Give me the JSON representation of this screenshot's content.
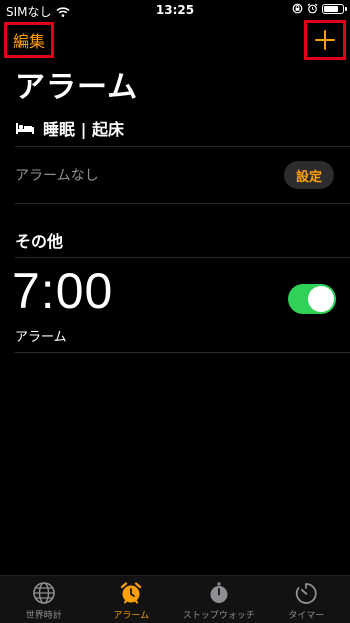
{
  "status_bar": {
    "carrier": "SIMなし",
    "time": "13:25",
    "battery_level": 0.85
  },
  "header": {
    "edit_label": "編集",
    "add_icon": "plus-icon",
    "title": "アラーム"
  },
  "sleep_section": {
    "icon": "bed-icon",
    "label": "睡眠 | 起床",
    "no_alarm_text": "アラームなし",
    "setup_label": "設定"
  },
  "other_section": {
    "heading": "その他",
    "alarms": [
      {
        "time": "7:00",
        "label": "アラーム",
        "enabled": true
      }
    ]
  },
  "tab_bar": {
    "tabs": [
      {
        "label": "世界時計",
        "icon": "globe-icon",
        "active": false
      },
      {
        "label": "アラーム",
        "icon": "alarm-clock-icon",
        "active": true
      },
      {
        "label": "ストップウォッチ",
        "icon": "stopwatch-icon",
        "active": false
      },
      {
        "label": "タイマー",
        "icon": "timer-icon",
        "active": false
      }
    ]
  },
  "colors": {
    "accent": "#ff9f0a",
    "toggle_on": "#30d158",
    "highlight_box": "#e0001a",
    "background": "#000000"
  }
}
